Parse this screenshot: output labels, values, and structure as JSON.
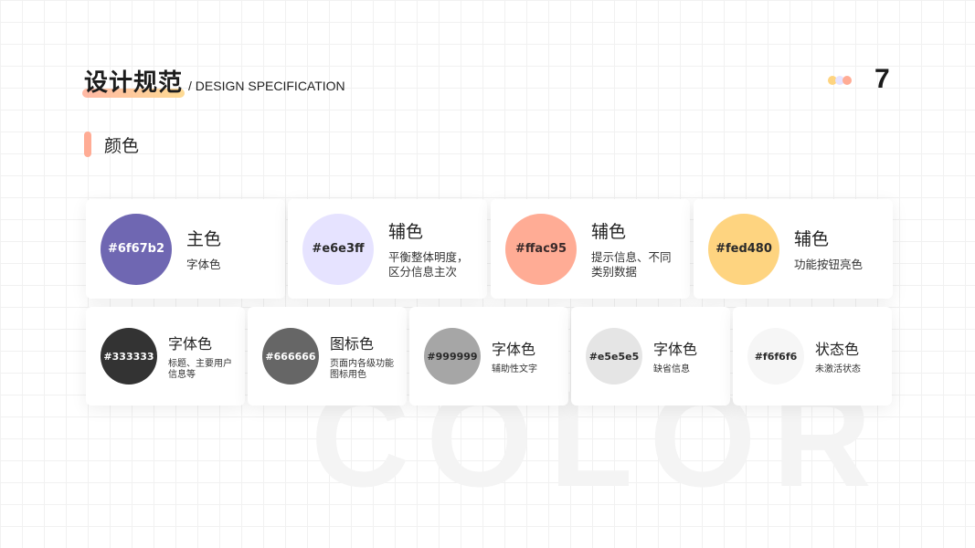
{
  "header": {
    "title_cn": "设计规范",
    "title_en": "/ DESIGN SPECIFICATION",
    "page_number": "7",
    "dot_colors": [
      "#fed480",
      "#e6e3ff",
      "#ffac95"
    ]
  },
  "section": {
    "label": "颜色"
  },
  "watermark": "COLOR",
  "primary_cards": [
    {
      "hex": "#6f67b2",
      "name": "主色",
      "desc": "字体色",
      "swatch_color": "#6f67b2",
      "text_color": "#ffffff"
    },
    {
      "hex": "#e6e3ff",
      "name": "辅色",
      "desc": "平衡整体明度，\n区分信息主次",
      "swatch_color": "#e6e3ff",
      "text_color": "#2a2a2a"
    },
    {
      "hex": "#ffac95",
      "name": "辅色",
      "desc": "提示信息、不同\n类别数据",
      "swatch_color": "#ffac95",
      "text_color": "#3a2a2a"
    },
    {
      "hex": "#fed480",
      "name": "辅色",
      "desc": "功能按钮亮色",
      "swatch_color": "#fed480",
      "text_color": "#2a2a2a"
    }
  ],
  "secondary_cards": [
    {
      "hex": "#333333",
      "name": "字体色",
      "desc": "标题、主要用户\n信息等",
      "swatch_color": "#333333",
      "text_color": "#ffffff"
    },
    {
      "hex": "#666666",
      "name": "图标色",
      "desc": "页面内各级功能\n图标用色",
      "swatch_color": "#666666",
      "text_color": "#ffffff"
    },
    {
      "hex": "#999999",
      "name": "字体色",
      "desc": "辅助性文字",
      "swatch_color": "#a6a6a6",
      "text_color": "#2a2a2a"
    },
    {
      "hex": "#e5e5e5",
      "name": "字体色",
      "desc": "缺省信息",
      "swatch_color": "#e5e5e5",
      "text_color": "#2a2a2a"
    },
    {
      "hex": "#f6f6f6",
      "name": "状态色",
      "desc": "未激活状态",
      "swatch_color": "#f6f6f6",
      "text_color": "#2a2a2a"
    }
  ]
}
